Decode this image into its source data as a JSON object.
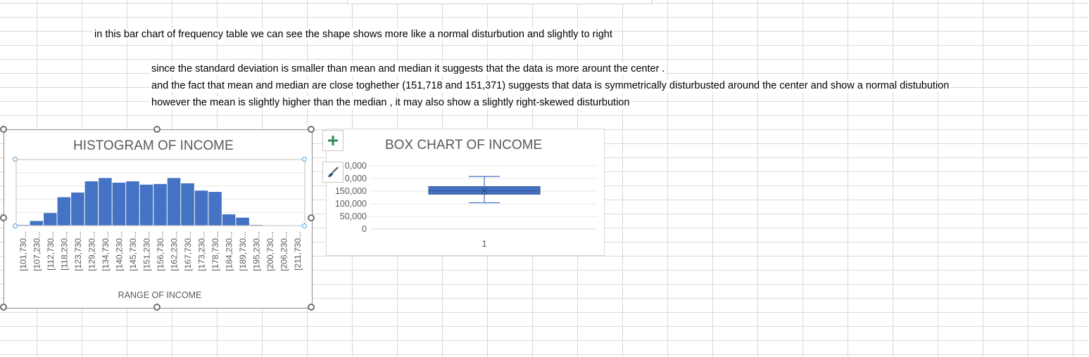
{
  "notes": {
    "line1": "in this bar chart of frequency table we can see the shape shows more like a normal disturbution and slightly to right",
    "line2": "since the standard deviation is smaller than mean and median it suggests that the data is more arount the center .",
    "line3": "and the fact that mean and median are close toghether (151,718 and 151,371) suggests that data is symmetrically disturbusted around the center and show a normal distubution",
    "line4": "however the mean is slightly higher than the median , it may also show a slightly right-skewed disturbution"
  },
  "chart_data": [
    {
      "type": "bar",
      "title": "HISTOGRAM OF INCOME",
      "xlabel": "RANGE OF INCOME",
      "ylabel": "",
      "categories": [
        "[101,730...",
        "[107,230...",
        "[112,730...",
        "[118,230...",
        "[123,730...",
        "[129,230...",
        "[134,730...",
        "[140,230...",
        "[145,730...",
        "[151,230...",
        "[156,730...",
        "[162,230...",
        "[167,730...",
        "[173,230...",
        "[178,730...",
        "[184,230...",
        "[189,730...",
        "[195,230...",
        "[200,730...",
        "[206,230...",
        "[211,730..."
      ],
      "values": [
        1,
        7,
        19,
        43,
        50,
        67,
        72,
        65,
        67,
        62,
        63,
        72,
        64,
        53,
        51,
        17,
        12,
        1,
        0,
        0,
        0
      ],
      "ylim": [
        0,
        100
      ],
      "color": "#4472c4",
      "grid": true
    },
    {
      "type": "box",
      "title": "BOX CHART OF INCOME",
      "categories": [
        "1"
      ],
      "y_ticks": [
        "0",
        "50,000",
        "100,000",
        "150,000",
        "200,000",
        "250,000"
      ],
      "y_ticks_visible": [
        "0",
        "50,000",
        "100,000",
        "150,000",
        "0,000",
        "0,000"
      ],
      "ylim": [
        0,
        250000
      ],
      "box": {
        "min": 104000,
        "q1": 138000,
        "median": 151371,
        "mean": 151718,
        "q3": 168000,
        "max": 208000
      },
      "color": "#4472c4",
      "grid": true
    }
  ],
  "ui": {
    "add_element_icon": "plus-icon",
    "style_icon": "paintbrush-icon"
  }
}
